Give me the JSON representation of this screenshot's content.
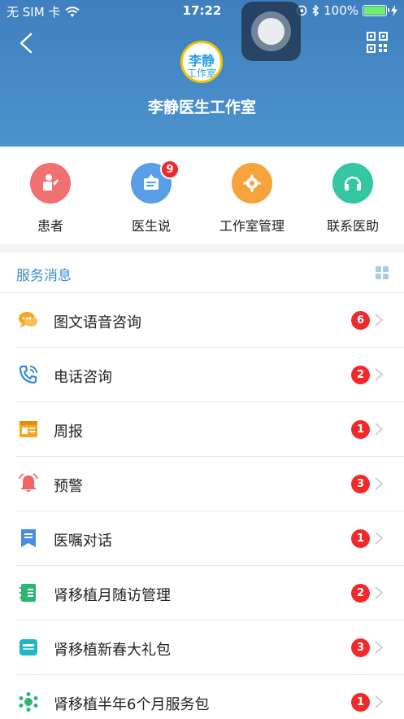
{
  "status_bar": {
    "carrier": "无 SIM 卡",
    "time": "17:22",
    "battery": "100%",
    "battery_level": 1.0
  },
  "header": {
    "logo_line1": "李静",
    "logo_line2": "工作室",
    "title": "李静医生工作室"
  },
  "quick_actions": [
    {
      "label": "患者",
      "icon": "patient-icon",
      "color": "#f0716f"
    },
    {
      "label": "医生说",
      "icon": "doctor-says-icon",
      "color": "#5a9ee8",
      "badge": "9"
    },
    {
      "label": "工作室管理",
      "icon": "gear-icon",
      "color": "#f5a33a"
    },
    {
      "label": "联系医助",
      "icon": "headset-icon",
      "color": "#35c6a3"
    }
  ],
  "service": {
    "heading": "服务消息",
    "items": [
      {
        "label": "图文语音咨询",
        "count": "6",
        "icon": "chat-bubbles-icon",
        "color": "#f5a623"
      },
      {
        "label": "电话咨询",
        "count": "2",
        "icon": "phone-icon",
        "color": "#3a8ccf"
      },
      {
        "label": "周报",
        "count": "1",
        "icon": "weekly-report-icon",
        "color": "#f5a623"
      },
      {
        "label": "预警",
        "count": "3",
        "icon": "alarm-bell-icon",
        "color": "#f06565"
      },
      {
        "label": "医嘱对话",
        "count": "1",
        "icon": "bookmark-icon",
        "color": "#4a8fdf"
      },
      {
        "label": "肾移植月随访管理",
        "count": "2",
        "icon": "notebook-icon",
        "color": "#2bb673"
      },
      {
        "label": "肾移植新春大礼包",
        "count": "3",
        "icon": "gift-pack-icon",
        "color": "#22b5c9"
      },
      {
        "label": "肾移植半年6个月服务包",
        "count": "1",
        "icon": "service-pack-icon",
        "color": "#2bb673"
      }
    ]
  }
}
